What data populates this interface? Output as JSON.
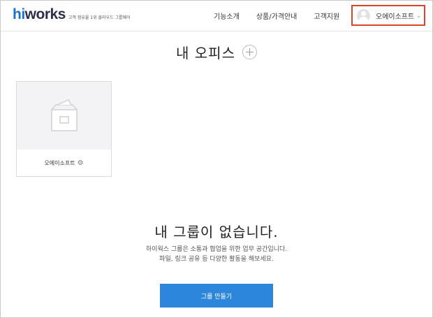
{
  "header": {
    "logo": {
      "prefix": "hi",
      "suffix": "works",
      "tagline": "고객 점유율 1위 클라우드 그룹웨어"
    },
    "nav": [
      {
        "label": "기능소개"
      },
      {
        "label": "상품/가격안내"
      },
      {
        "label": "고객지원"
      }
    ],
    "profile": {
      "name": "오에이소프트",
      "chevron": "⌄"
    }
  },
  "main": {
    "title": "내 오피스",
    "offices": [
      {
        "name": "오에이소프트",
        "icon": "gear-icon"
      }
    ],
    "empty": {
      "title": "내 그룹이 없습니다.",
      "desc_line1": "하이웍스 그룹은 소통과 협업을 위한 업무 공간입니다.",
      "desc_line2": "파일, 링크 공유 등 다양한 활동을 해보세요.",
      "button_label": "그룹 만들기"
    }
  },
  "colors": {
    "brand_dark": "#2b2f4a",
    "brand_blue": "#1a73c9",
    "button_blue": "#2c86dc",
    "highlight_border": "#d9442a"
  }
}
